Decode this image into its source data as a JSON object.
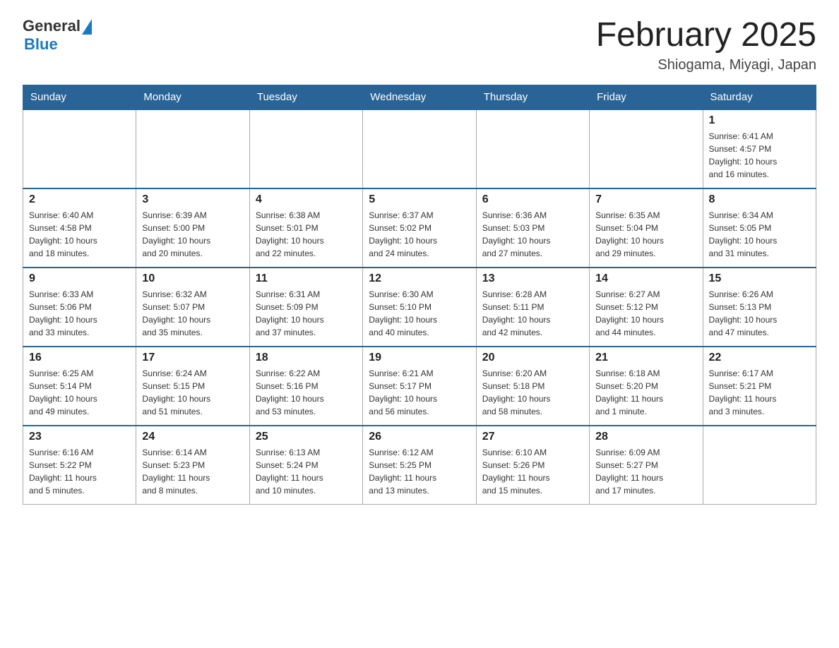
{
  "header": {
    "logo_general": "General",
    "logo_blue": "Blue",
    "title": "February 2025",
    "location": "Shiogama, Miyagi, Japan"
  },
  "weekdays": [
    "Sunday",
    "Monday",
    "Tuesday",
    "Wednesday",
    "Thursday",
    "Friday",
    "Saturday"
  ],
  "weeks": [
    [
      {
        "day": "",
        "info": ""
      },
      {
        "day": "",
        "info": ""
      },
      {
        "day": "",
        "info": ""
      },
      {
        "day": "",
        "info": ""
      },
      {
        "day": "",
        "info": ""
      },
      {
        "day": "",
        "info": ""
      },
      {
        "day": "1",
        "info": "Sunrise: 6:41 AM\nSunset: 4:57 PM\nDaylight: 10 hours\nand 16 minutes."
      }
    ],
    [
      {
        "day": "2",
        "info": "Sunrise: 6:40 AM\nSunset: 4:58 PM\nDaylight: 10 hours\nand 18 minutes."
      },
      {
        "day": "3",
        "info": "Sunrise: 6:39 AM\nSunset: 5:00 PM\nDaylight: 10 hours\nand 20 minutes."
      },
      {
        "day": "4",
        "info": "Sunrise: 6:38 AM\nSunset: 5:01 PM\nDaylight: 10 hours\nand 22 minutes."
      },
      {
        "day": "5",
        "info": "Sunrise: 6:37 AM\nSunset: 5:02 PM\nDaylight: 10 hours\nand 24 minutes."
      },
      {
        "day": "6",
        "info": "Sunrise: 6:36 AM\nSunset: 5:03 PM\nDaylight: 10 hours\nand 27 minutes."
      },
      {
        "day": "7",
        "info": "Sunrise: 6:35 AM\nSunset: 5:04 PM\nDaylight: 10 hours\nand 29 minutes."
      },
      {
        "day": "8",
        "info": "Sunrise: 6:34 AM\nSunset: 5:05 PM\nDaylight: 10 hours\nand 31 minutes."
      }
    ],
    [
      {
        "day": "9",
        "info": "Sunrise: 6:33 AM\nSunset: 5:06 PM\nDaylight: 10 hours\nand 33 minutes."
      },
      {
        "day": "10",
        "info": "Sunrise: 6:32 AM\nSunset: 5:07 PM\nDaylight: 10 hours\nand 35 minutes."
      },
      {
        "day": "11",
        "info": "Sunrise: 6:31 AM\nSunset: 5:09 PM\nDaylight: 10 hours\nand 37 minutes."
      },
      {
        "day": "12",
        "info": "Sunrise: 6:30 AM\nSunset: 5:10 PM\nDaylight: 10 hours\nand 40 minutes."
      },
      {
        "day": "13",
        "info": "Sunrise: 6:28 AM\nSunset: 5:11 PM\nDaylight: 10 hours\nand 42 minutes."
      },
      {
        "day": "14",
        "info": "Sunrise: 6:27 AM\nSunset: 5:12 PM\nDaylight: 10 hours\nand 44 minutes."
      },
      {
        "day": "15",
        "info": "Sunrise: 6:26 AM\nSunset: 5:13 PM\nDaylight: 10 hours\nand 47 minutes."
      }
    ],
    [
      {
        "day": "16",
        "info": "Sunrise: 6:25 AM\nSunset: 5:14 PM\nDaylight: 10 hours\nand 49 minutes."
      },
      {
        "day": "17",
        "info": "Sunrise: 6:24 AM\nSunset: 5:15 PM\nDaylight: 10 hours\nand 51 minutes."
      },
      {
        "day": "18",
        "info": "Sunrise: 6:22 AM\nSunset: 5:16 PM\nDaylight: 10 hours\nand 53 minutes."
      },
      {
        "day": "19",
        "info": "Sunrise: 6:21 AM\nSunset: 5:17 PM\nDaylight: 10 hours\nand 56 minutes."
      },
      {
        "day": "20",
        "info": "Sunrise: 6:20 AM\nSunset: 5:18 PM\nDaylight: 10 hours\nand 58 minutes."
      },
      {
        "day": "21",
        "info": "Sunrise: 6:18 AM\nSunset: 5:20 PM\nDaylight: 11 hours\nand 1 minute."
      },
      {
        "day": "22",
        "info": "Sunrise: 6:17 AM\nSunset: 5:21 PM\nDaylight: 11 hours\nand 3 minutes."
      }
    ],
    [
      {
        "day": "23",
        "info": "Sunrise: 6:16 AM\nSunset: 5:22 PM\nDaylight: 11 hours\nand 5 minutes."
      },
      {
        "day": "24",
        "info": "Sunrise: 6:14 AM\nSunset: 5:23 PM\nDaylight: 11 hours\nand 8 minutes."
      },
      {
        "day": "25",
        "info": "Sunrise: 6:13 AM\nSunset: 5:24 PM\nDaylight: 11 hours\nand 10 minutes."
      },
      {
        "day": "26",
        "info": "Sunrise: 6:12 AM\nSunset: 5:25 PM\nDaylight: 11 hours\nand 13 minutes."
      },
      {
        "day": "27",
        "info": "Sunrise: 6:10 AM\nSunset: 5:26 PM\nDaylight: 11 hours\nand 15 minutes."
      },
      {
        "day": "28",
        "info": "Sunrise: 6:09 AM\nSunset: 5:27 PM\nDaylight: 11 hours\nand 17 minutes."
      },
      {
        "day": "",
        "info": ""
      }
    ]
  ]
}
